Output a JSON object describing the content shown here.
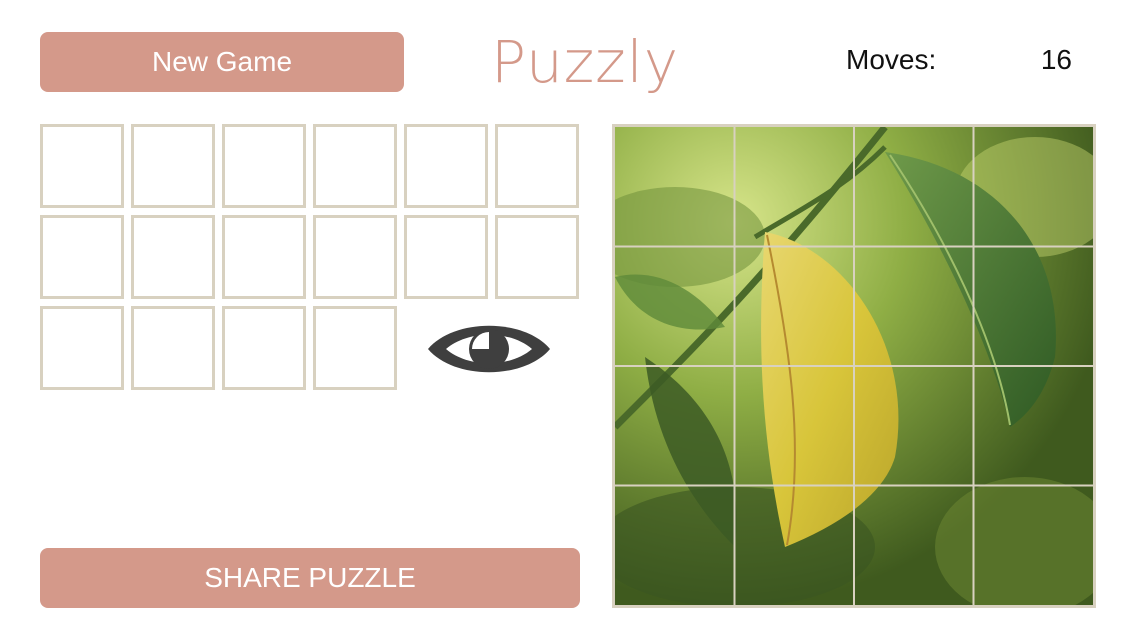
{
  "header": {
    "new_game_label": "New Game",
    "title": "Puzzly",
    "moves_label": "Moves:",
    "moves_value": "16"
  },
  "footer": {
    "share_label": "SHARE PUZZLE"
  },
  "tray": {
    "slot_count": 16,
    "peek_icon": "eye-icon"
  },
  "board": {
    "rows": 4,
    "cols": 4,
    "image_subject": "yellow-leaf-on-branch"
  },
  "colors": {
    "accent": "#d4998a",
    "slot_border": "#d8d1c0",
    "icon": "#3f3f3f"
  }
}
